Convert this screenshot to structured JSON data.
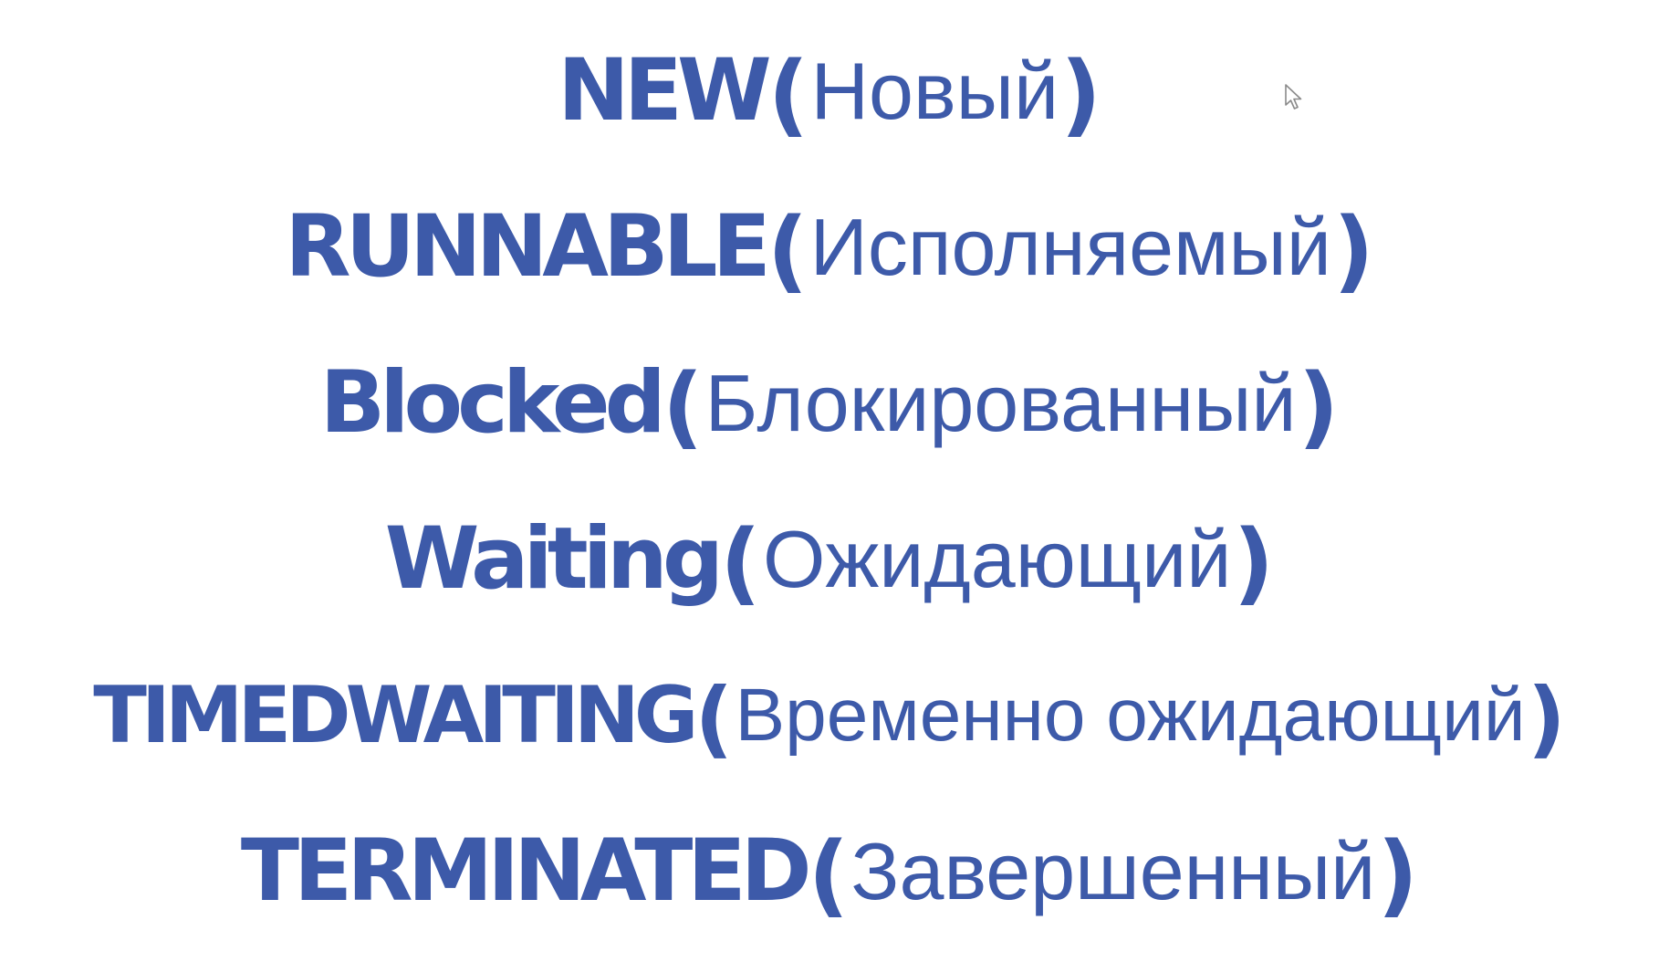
{
  "states": [
    {
      "name": "NEW",
      "translation": "Новый"
    },
    {
      "name": "RUNNABLE",
      "translation": "Исполняемый"
    },
    {
      "name": "Blocked",
      "translation": "Блокированный"
    },
    {
      "name": "Waiting",
      "translation": "Ожидающий"
    },
    {
      "name": "TIMEDWAITING",
      "translation": "Временно ожидающий"
    },
    {
      "name": "TERMINATED",
      "translation": "Завершенный"
    }
  ],
  "punctuation": {
    "open": "(",
    "close": ")"
  },
  "colors": {
    "text": "#3d5aa9",
    "background": "#ffffff"
  },
  "icons": {
    "cursor": "mouse-pointer-icon"
  }
}
